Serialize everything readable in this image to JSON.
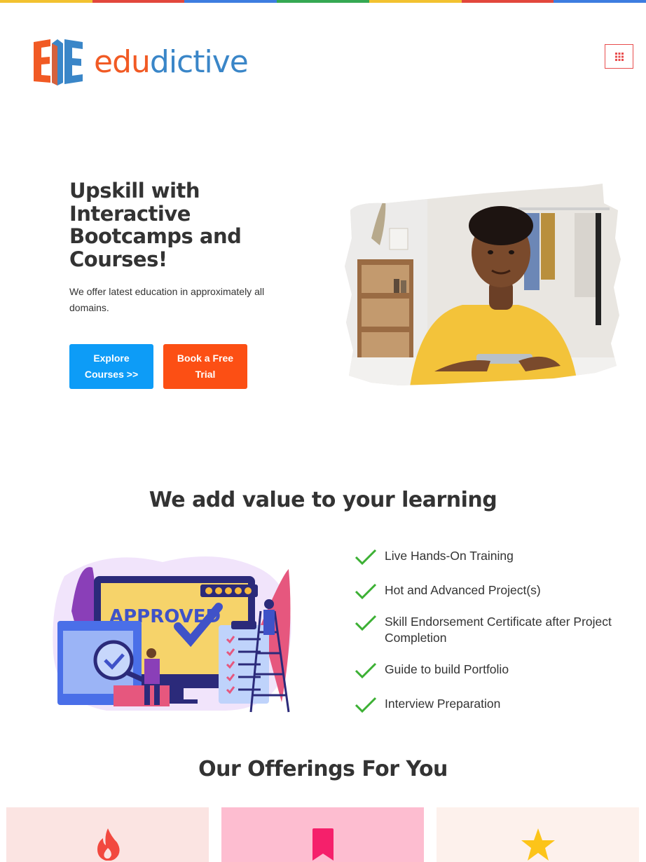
{
  "brand": {
    "name_part1": "edu",
    "name_part2": "dictive",
    "color_orange": "#f15a24",
    "color_blue": "#3a86c8"
  },
  "header": {
    "menu_icon": "grid-menu-icon"
  },
  "hero": {
    "title": "Upskill with Interactive Bootcamps and Courses!",
    "subtitle": "We offer latest education in approximately all domains.",
    "explore_button": "Explore Courses >>",
    "trial_button": "Book a Free Trial",
    "explore_color": "#0d9cf7",
    "trial_color": "#fc4f14"
  },
  "value_section": {
    "title": "We add value to your learning",
    "illustration_text": "APPROVED",
    "features": [
      "Live Hands-On Training",
      "Hot and Advanced Project(s)",
      "Skill Endorsement Certificate after Project Completion",
      "Guide to build Portfolio",
      "Interview Preparation"
    ],
    "check_color": "#3cb034"
  },
  "offerings": {
    "title": "Our Offerings For You",
    "cards": [
      {
        "icon": "flame-icon",
        "bg": "#fbe4e2",
        "color": "#f2493f"
      },
      {
        "icon": "bookmark-icon",
        "bg": "#fdbdd0",
        "color": "#f5206b"
      },
      {
        "icon": "star-icon",
        "bg": "#fdf1ec",
        "color": "#fcc419"
      }
    ]
  }
}
